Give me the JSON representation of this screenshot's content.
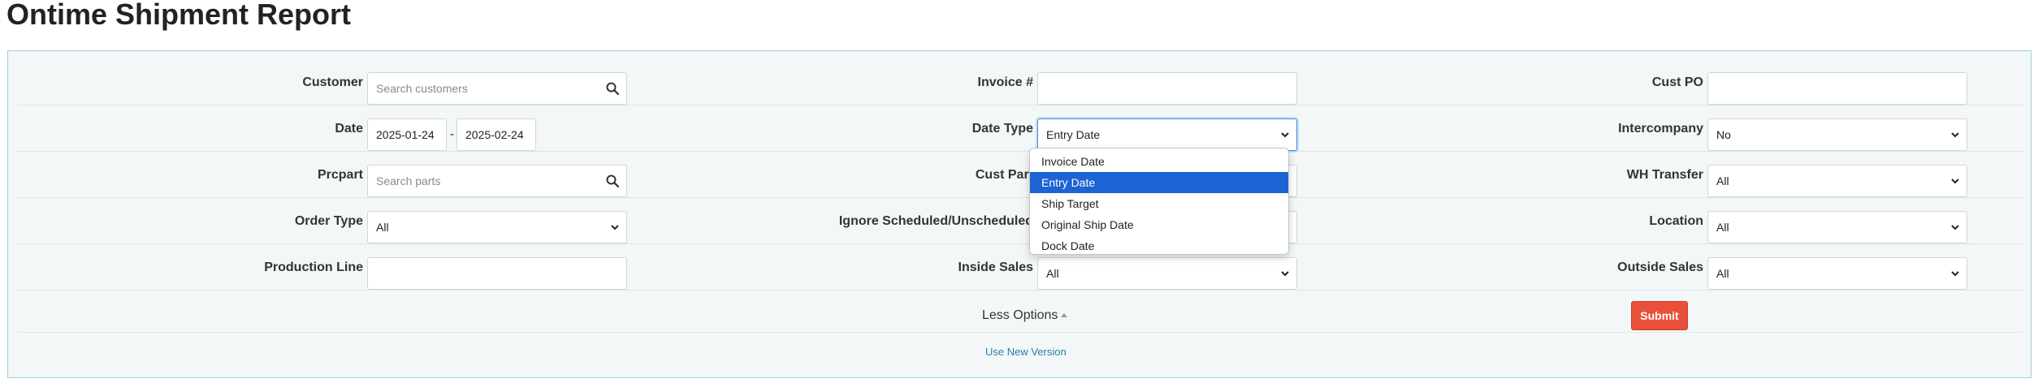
{
  "page": {
    "title": "Ontime Shipment Report"
  },
  "filters": {
    "customer": {
      "label": "Customer",
      "placeholder": "Search customers"
    },
    "invoice": {
      "label": "Invoice #",
      "value": ""
    },
    "cust_po": {
      "label": "Cust PO",
      "value": ""
    },
    "date": {
      "label": "Date",
      "from": "2025-01-24",
      "separator": "-",
      "to": "2025-02-24"
    },
    "date_type": {
      "label": "Date Type",
      "value": "Entry Date",
      "options": [
        "Invoice Date",
        "Entry Date",
        "Ship Target",
        "Original Ship Date",
        "Dock Date"
      ],
      "selected_index": 1
    },
    "intercompany": {
      "label": "Intercompany",
      "value": "No"
    },
    "prcpart": {
      "label": "Prcpart",
      "placeholder": "Search parts"
    },
    "cust_part": {
      "label": "Cust Part"
    },
    "wh_transfer": {
      "label": "WH Transfer",
      "value": "All"
    },
    "order_type": {
      "label": "Order Type",
      "value": "All"
    },
    "ignore_sched": {
      "label": "Ignore Scheduled/Unscheduled"
    },
    "location": {
      "label": "Location",
      "value": "All"
    },
    "production_line": {
      "label": "Production Line",
      "value": ""
    },
    "inside_sales": {
      "label": "Inside Sales",
      "value": "All"
    },
    "outside_sales": {
      "label": "Outside Sales",
      "value": "All"
    }
  },
  "actions": {
    "less_options": "Less Options",
    "submit": "Submit",
    "new_version": "Use New Version"
  },
  "colors": {
    "accent": "#1c63d3",
    "submit": "#e8503a",
    "panel_border": "#9fd0d8",
    "link": "#2a7ea8"
  }
}
